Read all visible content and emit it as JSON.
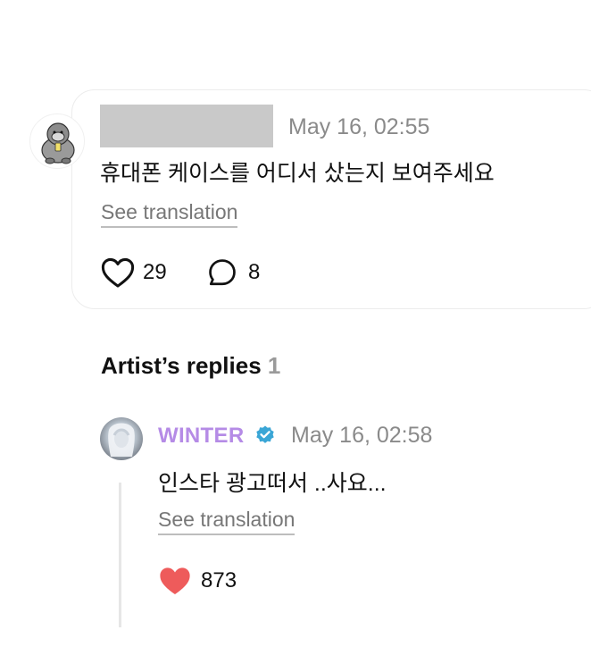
{
  "comment": {
    "time": "May 16, 02:55",
    "text": "휴대폰 케이스를 어디서 샀는지 보여주세요",
    "see_translation": "See translation",
    "likes": "29",
    "replies": "8"
  },
  "artist_replies": {
    "title": "Artist’s replies",
    "count": "1",
    "reply": {
      "author": "WINTER",
      "time": "May 16, 02:58",
      "text": "인스타 광고떠서 ..사요...",
      "see_translation": "See translation",
      "likes": "873"
    }
  },
  "colors": {
    "artist_name": "#b58be6",
    "verified_badge": "#3aa6d6",
    "heart_filled": "#ee5b5b"
  }
}
